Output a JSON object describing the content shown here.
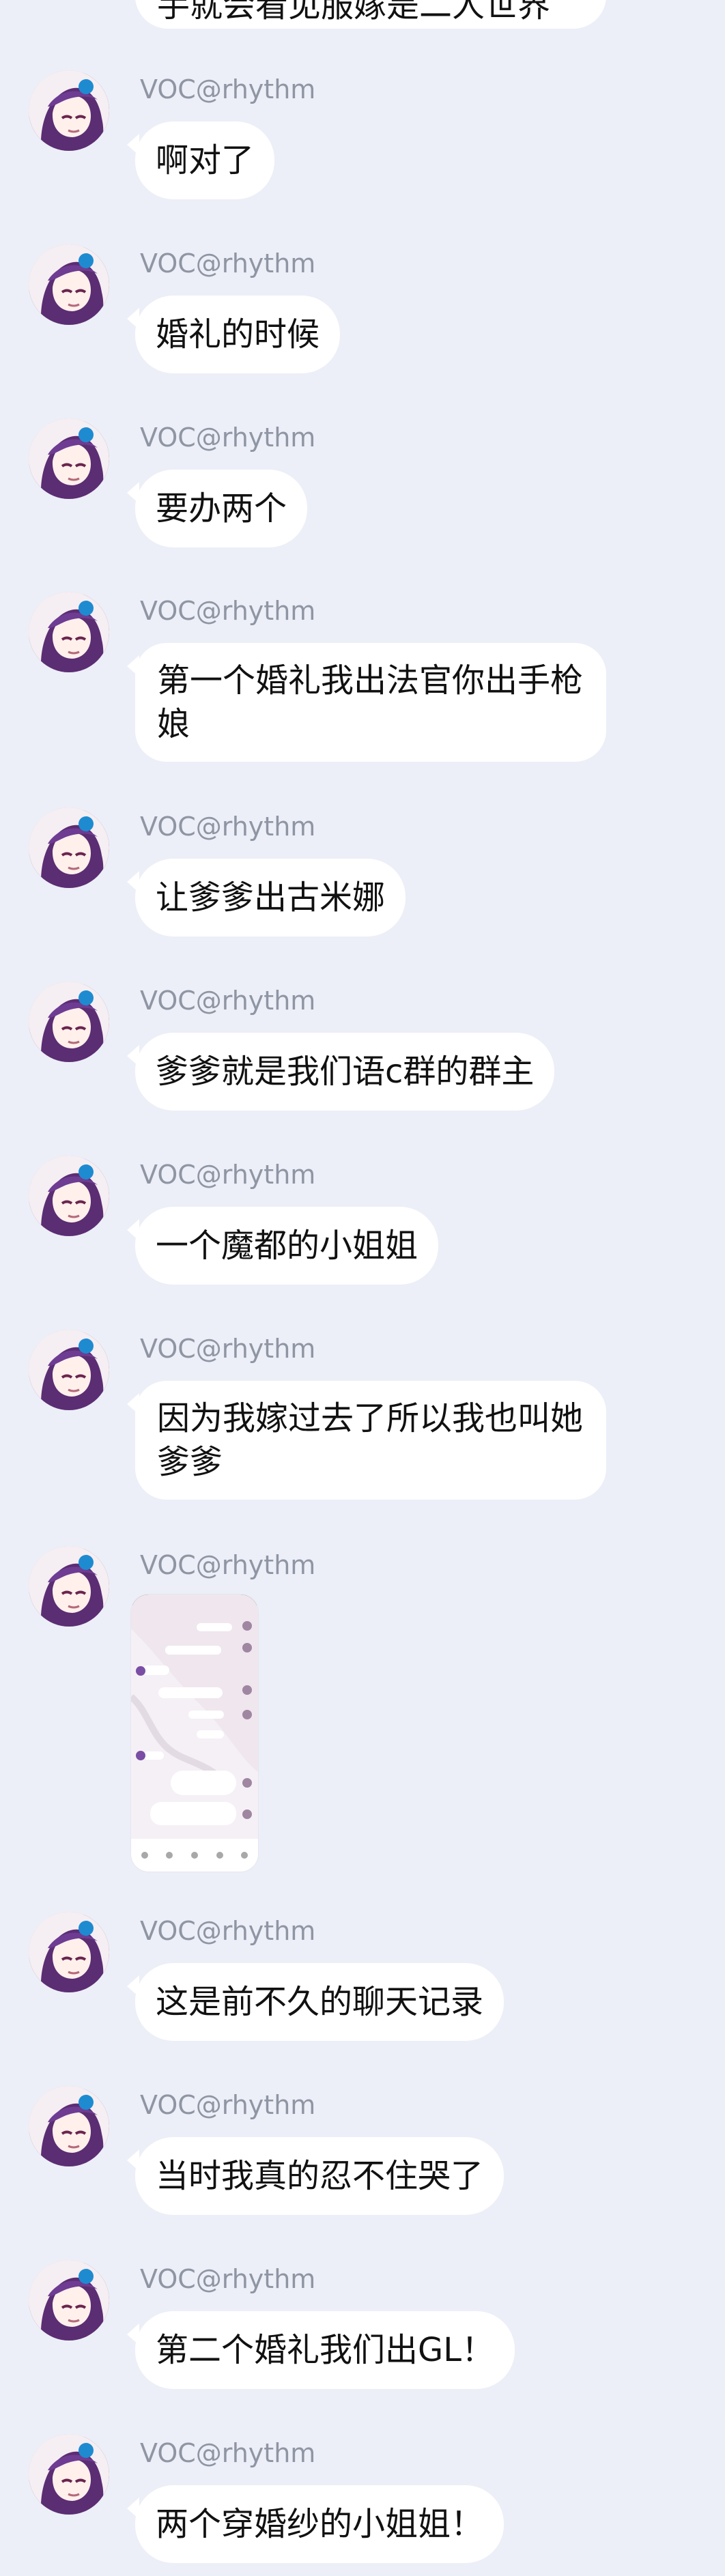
{
  "chat": {
    "top_partial": "手就会看见服嫁是二人世界",
    "messages": [
      {
        "sender": "VOC@rhythm",
        "text": "啊对了"
      },
      {
        "sender": "VOC@rhythm",
        "text": "婚礼的时候"
      },
      {
        "sender": "VOC@rhythm",
        "text": "要办两个"
      },
      {
        "sender": "VOC@rhythm",
        "text": "第一个婚礼我出法官你出手枪娘"
      },
      {
        "sender": "VOC@rhythm",
        "text": "让爹爹出古米娜"
      },
      {
        "sender": "VOC@rhythm",
        "text": "爹爹就是我们语c群的群主"
      },
      {
        "sender": "VOC@rhythm",
        "text": "一个魔都的小姐姐"
      },
      {
        "sender": "VOC@rhythm",
        "text": "因为我嫁过去了所以我也叫她爹爹"
      },
      {
        "sender": "VOC@rhythm",
        "text": "",
        "image": "chat screenshot"
      },
      {
        "sender": "VOC@rhythm",
        "text": "这是前不久的聊天记录"
      },
      {
        "sender": "VOC@rhythm",
        "text": "当时我真的忍不住哭了"
      },
      {
        "sender": "VOC@rhythm",
        "text": "第二个婚礼我们出GL！"
      },
      {
        "sender": "VOC@rhythm",
        "text": "两个穿婚纱的小姐姐！"
      }
    ]
  },
  "colors": {
    "background": "#eceff7",
    "bubble": "#ffffff",
    "sender": "#8f95a3",
    "text": "#111111"
  }
}
